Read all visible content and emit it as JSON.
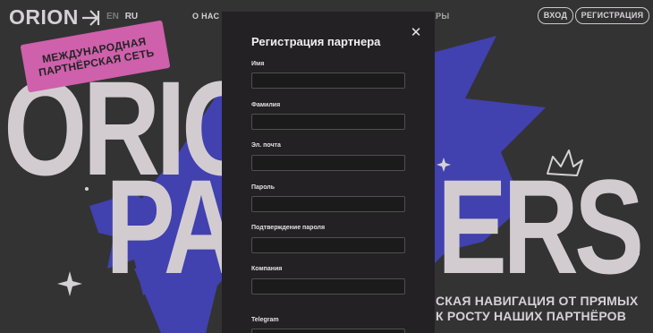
{
  "header": {
    "logo_text": "ORION",
    "lang_en": "EN",
    "lang_ru": "RU",
    "nav_about": "О НАС",
    "nav_partners": "РТНЕРЫ",
    "login_label": "ВХОД",
    "register_label": "РЕГИСТРАЦИЯ"
  },
  "hero": {
    "tag_line1": "МЕЖДУНАРОДНАЯ",
    "tag_line2": "ПАРТНЁРСКАЯ СЕТЬ",
    "big_word1": "ORIO",
    "big_word2": "PARTNERS",
    "tagline_line1": "СКАЯ НАВИГАЦИЯ ОТ ПРЯМЫХ",
    "tagline_line2": "К РОСТУ НАШИХ ПАРТНЁРОВ"
  },
  "colors": {
    "background": "#3b3b3b",
    "star_blue": "#4b4ac8",
    "tag_pink": "#ec6ec4",
    "modal_bg": "#232123"
  },
  "modal": {
    "title": "Регистрация партнера",
    "close_icon": "close-icon",
    "fields": [
      {
        "label": "Имя",
        "value": ""
      },
      {
        "label": "Фамилия",
        "value": ""
      },
      {
        "label": "Эл. почта",
        "value": ""
      },
      {
        "label": "Пароль",
        "value": ""
      },
      {
        "label": "Подтверждение пароля",
        "value": ""
      },
      {
        "label": "Компания",
        "value": ""
      },
      {
        "label": "Telegram",
        "value": ""
      }
    ]
  }
}
